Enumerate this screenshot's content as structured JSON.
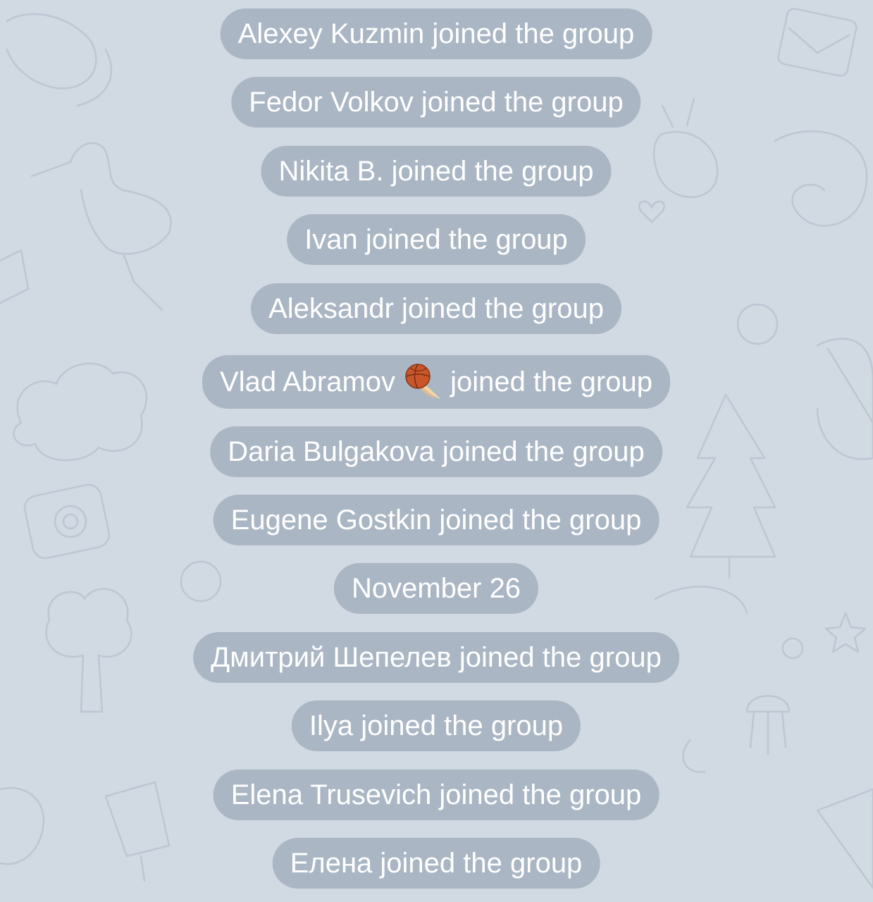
{
  "chat": {
    "service_messages": [
      {
        "text": "Alexey Kuzmin joined the group"
      },
      {
        "text": "Fedor Volkov joined the group"
      },
      {
        "text": "Nikita B. joined the group"
      },
      {
        "text": "Ivan joined the group"
      },
      {
        "text": "Aleksandr joined the group"
      },
      {
        "name": "Vlad Abramov",
        "suffix": "joined the group",
        "emoji_icon": "basketball-comet-emoji"
      },
      {
        "text": "Daria Bulgakova joined the group"
      },
      {
        "text": "Eugene Gostkin joined the group"
      },
      {
        "text": "November 26",
        "kind": "date-separator"
      },
      {
        "text": "Дмитрий Шепелев joined the group"
      },
      {
        "text": "Ilya joined the group"
      },
      {
        "text": "Elena Trusevich joined the group"
      },
      {
        "text": "Елена joined the group"
      }
    ]
  },
  "theme": {
    "background": "#d1d9e2",
    "pill_background": "#aab6c4",
    "pill_text": "#ffffff",
    "doodle_stroke": "#bcc7d4"
  }
}
